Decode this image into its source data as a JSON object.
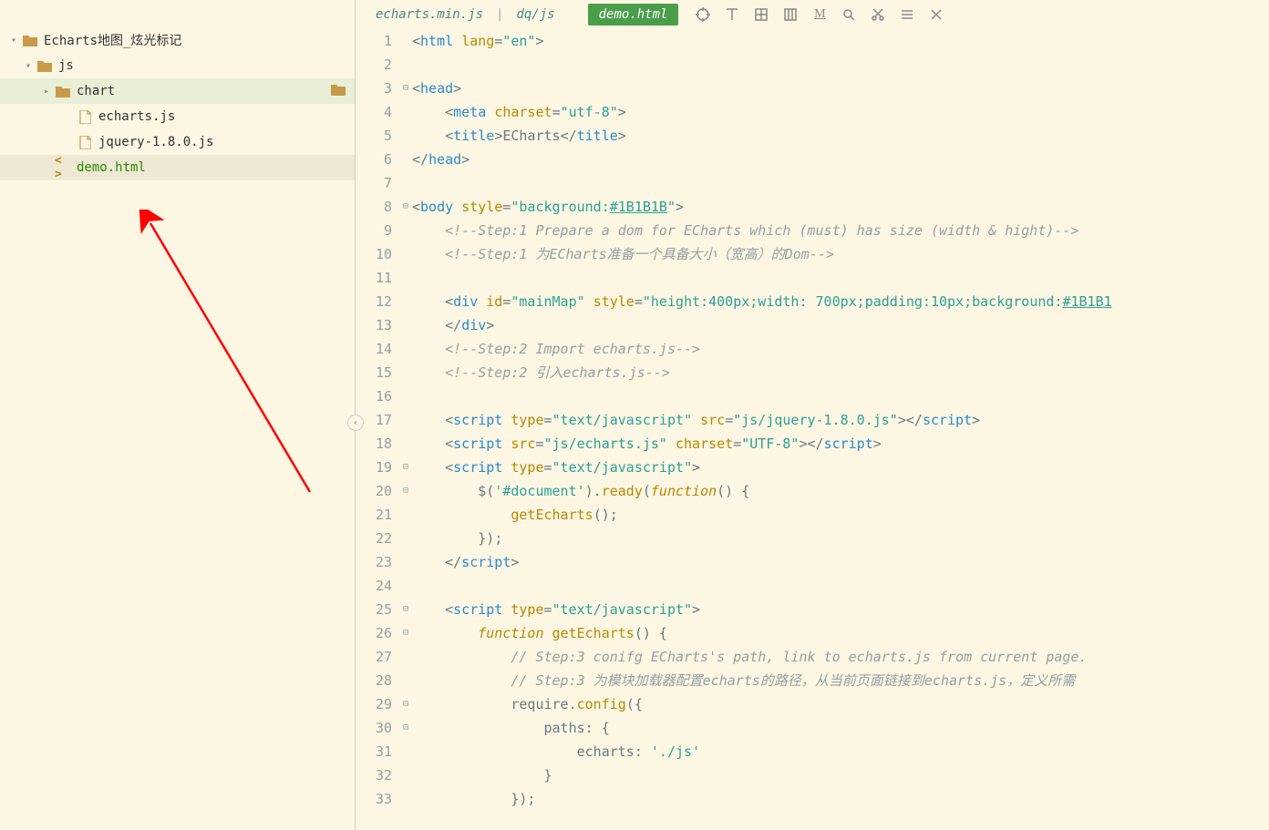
{
  "sidebar": {
    "items": [
      {
        "label": "Echarts地图_炫光标记",
        "type": "folder",
        "indent": 0,
        "expanded": true
      },
      {
        "label": "js",
        "type": "folder",
        "indent": 1,
        "expanded": true
      },
      {
        "label": "chart",
        "type": "folder",
        "indent": 2,
        "expanded": false,
        "selected": true
      },
      {
        "label": "echarts.js",
        "type": "file",
        "indent": 3
      },
      {
        "label": "jquery-1.8.0.js",
        "type": "file",
        "indent": 3
      },
      {
        "label": "demo.html",
        "type": "code",
        "indent": 2,
        "active": true
      }
    ]
  },
  "tabs": {
    "inactive1": "echarts.min.js",
    "sep": "|",
    "inactive2": "dq/js",
    "active": "demo.html"
  },
  "toolbar_icons": [
    "target",
    "tab-right",
    "grid",
    "columns",
    "match",
    "search",
    "cut",
    "menu",
    "close"
  ],
  "code_lines": [
    {
      "n": 1,
      "html": "<span class='punct'>&lt;</span><span class='tag'>html</span> <span class='attr'>lang</span><span class='punct'>=</span><span class='str'>\"en\"</span><span class='punct'>&gt;</span>"
    },
    {
      "n": 2,
      "html": ""
    },
    {
      "n": 3,
      "fold": "⊟",
      "html": "<span class='punct'>&lt;</span><span class='tag'>head</span><span class='punct'>&gt;</span>"
    },
    {
      "n": 4,
      "html": "    <span class='punct'>&lt;</span><span class='tag'>meta</span> <span class='attr'>charset</span><span class='punct'>=</span><span class='str'>\"utf-8\"</span><span class='punct'>&gt;</span>"
    },
    {
      "n": 5,
      "html": "    <span class='punct'>&lt;</span><span class='tag'>title</span><span class='punct'>&gt;</span>ECharts<span class='punct'>&lt;/</span><span class='tag'>title</span><span class='punct'>&gt;</span>"
    },
    {
      "n": 6,
      "html": "<span class='punct'>&lt;/</span><span class='tag'>head</span><span class='punct'>&gt;</span>"
    },
    {
      "n": 7,
      "html": ""
    },
    {
      "n": 8,
      "fold": "⊟",
      "html": "<span class='punct'>&lt;</span><span class='tag'>body</span> <span class='attr'>style</span><span class='punct'>=</span><span class='str'>\"background:<span class='underline'>#1B1B1B</span>\"</span><span class='punct'>&gt;</span>"
    },
    {
      "n": 9,
      "html": "    <span class='comment'>&lt;!--Step:1 Prepare a dom for ECharts which (must) has size (width &amp; hight)--&gt;</span>"
    },
    {
      "n": 10,
      "html": "    <span class='comment'>&lt;!--Step:1 为ECharts准备一个具备大小（宽高）的Dom--&gt;</span>"
    },
    {
      "n": 11,
      "html": ""
    },
    {
      "n": 12,
      "html": "    <span class='punct'>&lt;</span><span class='tag'>div</span> <span class='attr'>id</span><span class='punct'>=</span><span class='str'>\"mainMap\"</span> <span class='attr'>style</span><span class='punct'>=</span><span class='str'>\"height:400px;width: 700px;padding:10px;background:<span class='underline'>#1B1B1</span></span>"
    },
    {
      "n": 13,
      "html": "    <span class='punct'>&lt;/</span><span class='tag'>div</span><span class='punct'>&gt;</span>"
    },
    {
      "n": 14,
      "html": "    <span class='comment'>&lt;!--Step:2 Import echarts.js--&gt;</span>"
    },
    {
      "n": 15,
      "html": "    <span class='comment'>&lt;!--Step:2 引入echarts.js--&gt;</span>"
    },
    {
      "n": 16,
      "html": ""
    },
    {
      "n": 17,
      "html": "    <span class='punct'>&lt;</span><span class='tag'>script</span> <span class='attr'>type</span><span class='punct'>=</span><span class='str'>\"text/javascript\"</span> <span class='attr'>src</span><span class='punct'>=</span><span class='str'>\"js/jquery-1.8.0.js\"</span><span class='punct'>&gt;&lt;/</span><span class='tag'>script</span><span class='punct'>&gt;</span>"
    },
    {
      "n": 18,
      "html": "    <span class='punct'>&lt;</span><span class='tag'>script</span> <span class='attr'>src</span><span class='punct'>=</span><span class='str'>\"js/echarts.js\"</span> <span class='attr'>charset</span><span class='punct'>=</span><span class='str'>\"UTF-8\"</span><span class='punct'>&gt;&lt;/</span><span class='tag'>script</span><span class='punct'>&gt;</span>"
    },
    {
      "n": 19,
      "fold": "⊟",
      "html": "    <span class='punct'>&lt;</span><span class='tag'>script</span> <span class='attr'>type</span><span class='punct'>=</span><span class='str'>\"text/javascript\"</span><span class='punct'>&gt;</span>"
    },
    {
      "n": 20,
      "fold": "⊟",
      "html": "        $(<span class='str'>'#document'</span>).<span class='func-call'>ready</span>(<span class='fn'>function</span>() {"
    },
    {
      "n": 21,
      "html": "            <span class='func-call'>getEcharts</span>();"
    },
    {
      "n": 22,
      "html": "        });"
    },
    {
      "n": 23,
      "html": "    <span class='punct'>&lt;/</span><span class='tag'>script</span><span class='punct'>&gt;</span>"
    },
    {
      "n": 24,
      "html": ""
    },
    {
      "n": 25,
      "fold": "⊟",
      "html": "    <span class='punct'>&lt;</span><span class='tag'>script</span> <span class='attr'>type</span><span class='punct'>=</span><span class='str'>\"text/javascript\"</span><span class='punct'>&gt;</span>"
    },
    {
      "n": 26,
      "fold": "⊟",
      "html": "        <span class='fn'>function</span> <span class='func-call'>getEcharts</span>() {"
    },
    {
      "n": 27,
      "html": "            <span class='comment'>// Step:3 conifg ECharts's path, link to echarts.js from current page.</span>"
    },
    {
      "n": 28,
      "html": "            <span class='comment'>// Step:3 为模块加载器配置echarts的路径，从当前页面链接到echarts.js，定义所需</span>"
    },
    {
      "n": 29,
      "fold": "⊟",
      "html": "            require.<span class='func-call'>config</span>({"
    },
    {
      "n": 30,
      "fold": "⊟",
      "html": "                paths: {"
    },
    {
      "n": 31,
      "html": "                    echarts: <span class='str'>'./js'</span>"
    },
    {
      "n": 32,
      "html": "                }"
    },
    {
      "n": 33,
      "html": "            });"
    }
  ]
}
